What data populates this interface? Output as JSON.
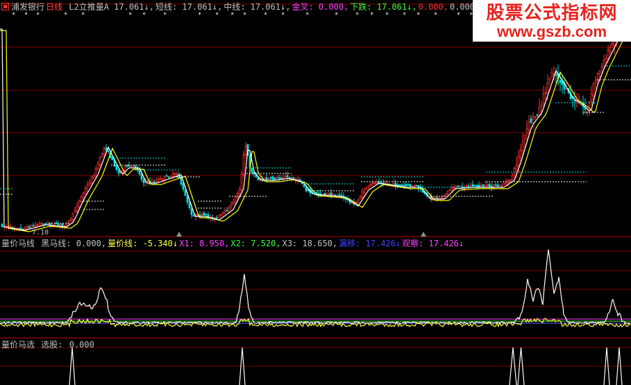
{
  "main": {
    "stock_name": "浦发银行",
    "period": "日线",
    "indicators": [
      {
        "label": "L2立推量A",
        "value": "17.061",
        "arrow": "↓",
        "color": "#c0c0c0"
      },
      {
        "label": "短线:",
        "value": "17.061",
        "arrow": "↓",
        "color": "#c0c0c0"
      },
      {
        "label": "中线:",
        "value": "17.061",
        "arrow": "↓",
        "color": "#c0c0c0"
      },
      {
        "label": "金叉:",
        "value": "0.000",
        "arrow": "",
        "color": "#ff40ff"
      },
      {
        "label": "下跌:",
        "value": "17.061",
        "arrow": "↓",
        "color": "#40ff40"
      },
      {
        "label": "",
        "value": "0.000",
        "arrow": "",
        "color": "#ff3030"
      },
      {
        "label": "",
        "value": "0.000",
        "arrow": "",
        "color": "#c0c0c0"
      }
    ],
    "low_marker": "7.10"
  },
  "volume": {
    "name": "量价马线",
    "indicators": [
      {
        "label": "黑马线:",
        "value": "0.000,",
        "color": "#c0c0c0"
      },
      {
        "label": "量价线:",
        "value": "-5.340↓",
        "color": "#ffff40"
      },
      {
        "label": "X1:",
        "value": "8.950,",
        "color": "#ff40ff"
      },
      {
        "label": "X2:",
        "value": "7.520,",
        "color": "#40ff40"
      },
      {
        "label": "X3:",
        "value": "18.650,",
        "color": "#c0c0c0"
      },
      {
        "label": "漏移:",
        "value": "17.426↓",
        "color": "#4040ff"
      },
      {
        "label": "观察:",
        "value": "17.426↓",
        "color": "#ff40ff"
      }
    ]
  },
  "selector": {
    "name": "量价马选",
    "label": "选股:",
    "value": "0.000"
  },
  "watermark": {
    "line1": "股票公式指标网",
    "line2": "www.gszb.com"
  },
  "colors": {
    "up": "#ff3030",
    "down": "#00e0e0",
    "grid": "#800000",
    "ma_white": "#ffffff",
    "ma_yellow": "#ffff00"
  }
}
